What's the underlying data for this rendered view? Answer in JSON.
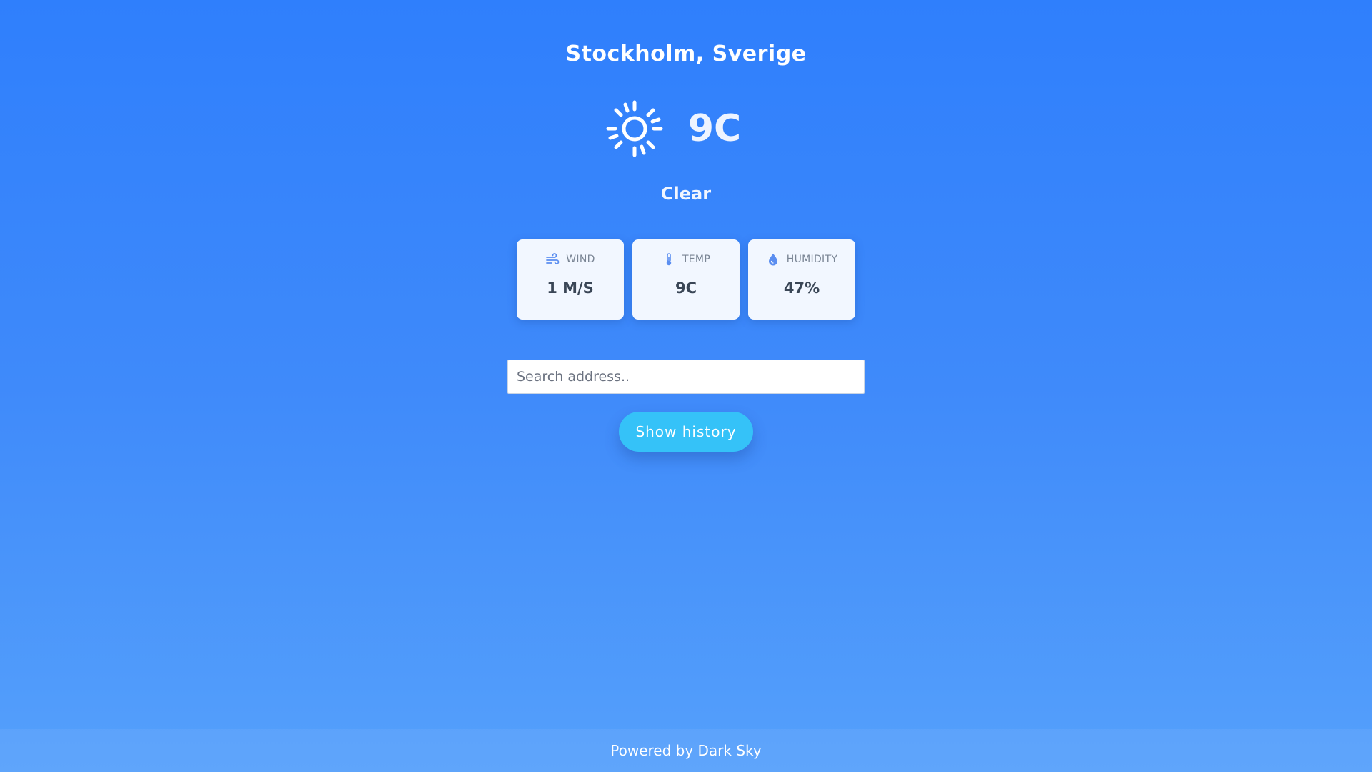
{
  "location": "Stockholm, Sverige",
  "current": {
    "icon": "sun-icon",
    "temperature": "9C",
    "summary": "Clear"
  },
  "stats": [
    {
      "icon": "wind-icon",
      "label": "WIND",
      "value": "1 M/S"
    },
    {
      "icon": "thermometer-icon",
      "label": "TEMP",
      "value": "9C"
    },
    {
      "icon": "droplet-icon",
      "label": "HUMIDITY",
      "value": "47%"
    }
  ],
  "search": {
    "placeholder": "Search address.."
  },
  "history_button": {
    "label": "Show history"
  },
  "footer": {
    "text": "Powered by Dark Sky"
  },
  "colors": {
    "background_top": "#2f7ffc",
    "background_bottom": "#55a0fb",
    "button": "#35c2f8",
    "card": "#f2f7ff",
    "icon_accent": "#5b8ef0"
  }
}
